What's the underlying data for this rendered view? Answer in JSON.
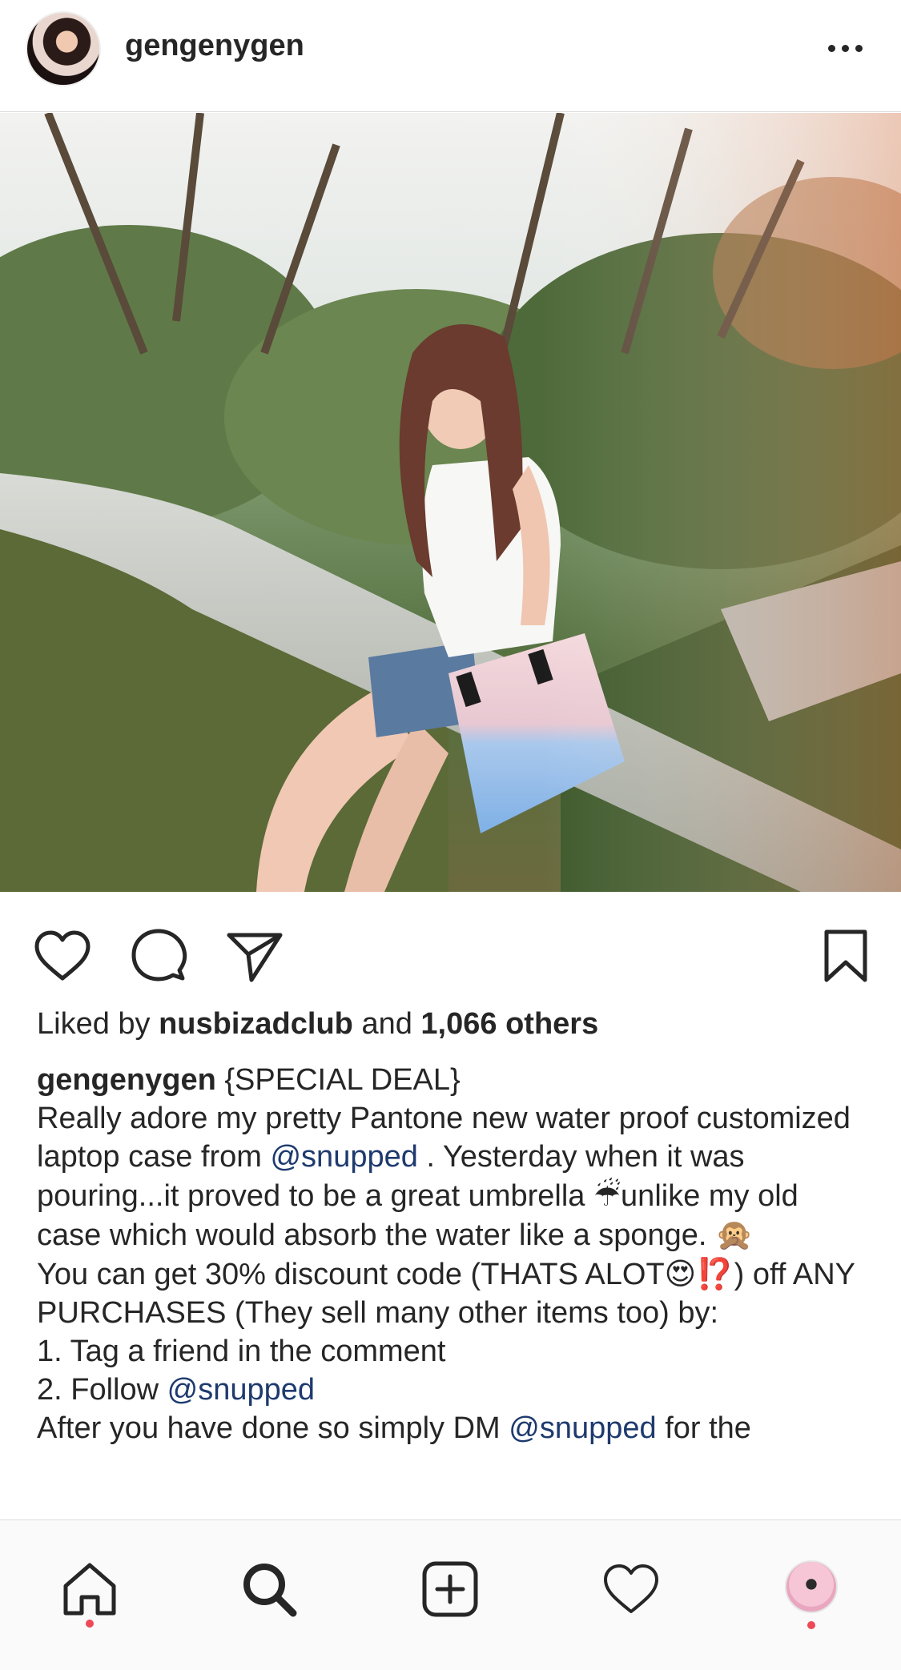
{
  "post": {
    "username": "gengenygen",
    "more_icon": "more-horizontal-icon"
  },
  "photo": {
    "icon": "post-photo"
  },
  "actions": {
    "like_icon": "heart-icon",
    "comment_icon": "comment-icon",
    "share_icon": "send-icon",
    "save_icon": "bookmark-icon"
  },
  "likes": {
    "prefix": "Liked by ",
    "first_liker": "nusbizadclub",
    "middle": " and ",
    "others": "1,066 others"
  },
  "caption": {
    "username": "gengenygen",
    "line1_tail": " {SPECIAL DEAL}",
    "p1_a": "Really adore my pretty Pantone new water proof customized laptop case from ",
    "mention1": "@snupped",
    "p1_b": " . Yesterday when it was pouring...it proved to be a great umbrella ",
    "umbrella_emoji": "☔",
    "p1_c": "unlike my old case which would absorb the water like a sponge. ",
    "monkey_emoji": "🙊",
    "p2_a": "You can get 30% discount code (THATS ALOT",
    "heart_eyes_emoji": "😍",
    "interrobang_emoji": "⁉️",
    "p2_b": ") off ANY PURCHASES (They sell many other items too) by:",
    "step1": "1. Tag a friend in the comment",
    "step2_a": "2. Follow ",
    "mention2": "@snupped",
    "step3_partial": "After you have done so simply DM ",
    "mention3": "@snupped",
    "step3_tail": " for the"
  },
  "bottom_nav": {
    "home_icon": "home-icon",
    "search_icon": "search-icon",
    "new_post_icon": "add-post-icon",
    "activity_icon": "heart-icon",
    "profile_icon": "profile-avatar"
  },
  "colors": {
    "text": "#262626",
    "mention": "#1e3a6e",
    "notification_dot": "#ed4956",
    "divider": "#dbdbdb"
  }
}
